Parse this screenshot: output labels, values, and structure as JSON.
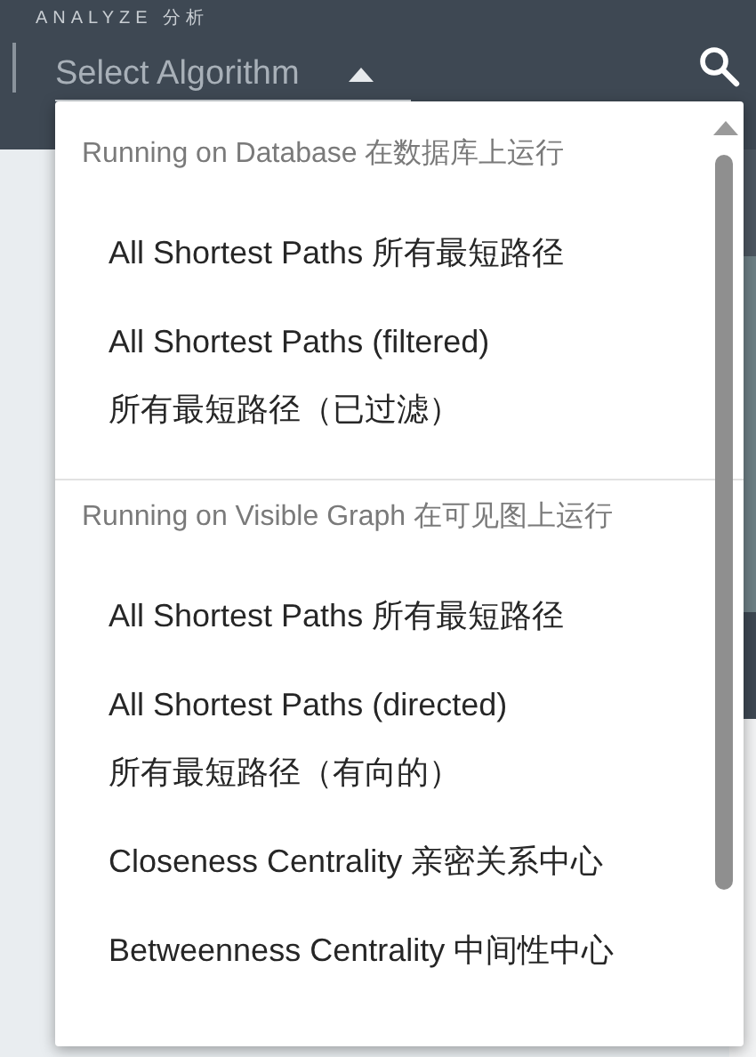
{
  "header": {
    "section_label": "ANALYZE 分析",
    "select": {
      "placeholder": "Select Algorithm",
      "expanded": true
    }
  },
  "menu": {
    "sections": [
      {
        "header": "Running on Database 在数据库上运行",
        "items": [
          {
            "label": "All Shortest Paths 所有最短路径"
          },
          {
            "label": "All Shortest Paths (filtered)\n所有最短路径（已过滤）"
          }
        ]
      },
      {
        "header": "Running on Visible Graph 在可见图上运行",
        "items": [
          {
            "label": "All Shortest Paths 所有最短路径"
          },
          {
            "label": "All Shortest Paths (directed)\n所有最短路径（有向的）"
          },
          {
            "label": "Closeness Centrality 亲密关系中心"
          },
          {
            "label": "Betweenness Centrality 中间性中心"
          }
        ]
      }
    ]
  }
}
